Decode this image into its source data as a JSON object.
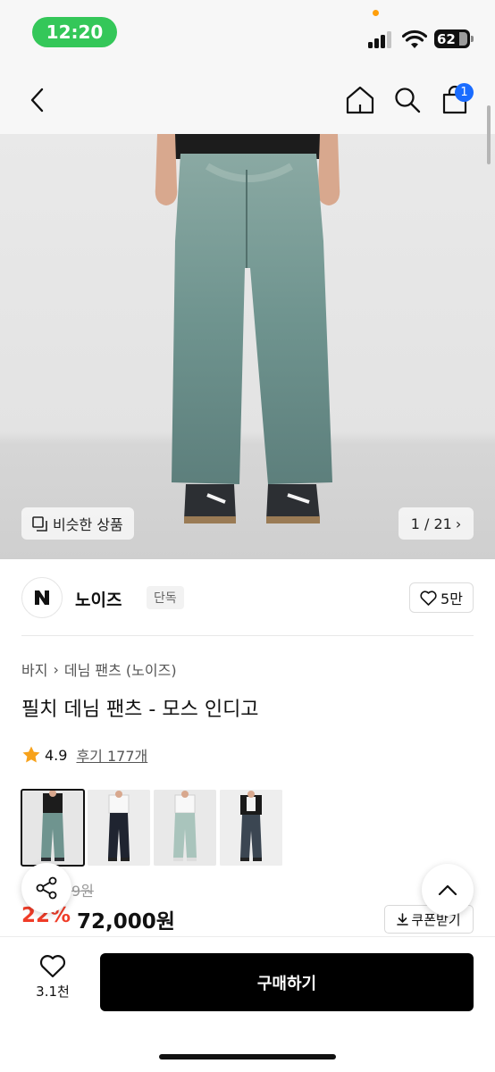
{
  "status_bar": {
    "time": "12:20",
    "battery": "62"
  },
  "header": {
    "back_icon": "chevron-left-icon",
    "home_icon": "home-icon",
    "search_icon": "search-icon",
    "cart_icon": "shopping-bag-icon",
    "cart_badge": "1",
    "badge_color": "#1a6cff"
  },
  "gallery": {
    "similar_label": "비슷한 상품",
    "counter": "1 / 21"
  },
  "brand": {
    "name": "노이즈",
    "badge": "단독",
    "likes": "5만"
  },
  "breadcrumb": {
    "category": "바지",
    "subcategory": "데님 팬츠 (노이즈)"
  },
  "product": {
    "title": "필치 데님 팬츠 - 모스 인디고",
    "rating": "4.9",
    "reviews": "후기 177개",
    "original_price": "9원",
    "discount": "22%",
    "price": "72,000원",
    "coupon_label": "쿠폰받기",
    "discount_color": "#f03c28",
    "star_color": "#f7a21b"
  },
  "bottom_bar": {
    "wish_count": "3.1천",
    "buy_label": "구매하기"
  }
}
